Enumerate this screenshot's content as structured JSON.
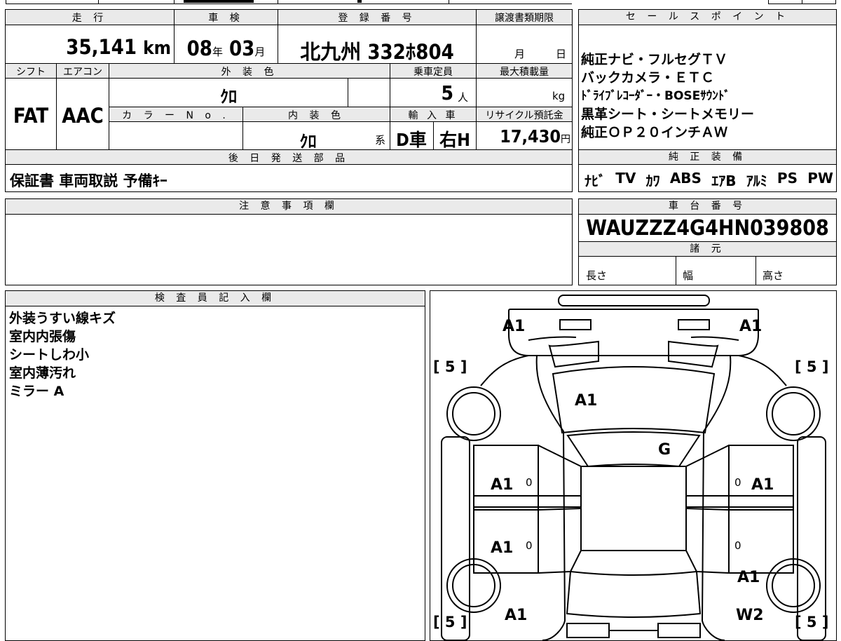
{
  "headers": {
    "mileage": "走 行",
    "inspection": "車 検",
    "registration": "登 録 番 号",
    "transfer_deadline": "譲渡書類期限",
    "sales_point": "セ ー ル ス ポ イ ン ト",
    "shift": "シフト",
    "aircon": "エアコン",
    "exterior_color": "外 装 色",
    "capacity": "乗車定員",
    "max_load": "最大積載量",
    "color_no": "カ ラ ー N o .",
    "interior_color": "内 装 色",
    "import": "輸 入 車",
    "recycle": "リサイクル預託金",
    "later_parts": "後 日 発 送 部 品",
    "genuine_equipment": "純 正 装 備",
    "notes": "注 意 事 項 欄",
    "chassis_no": "車 台 番 号",
    "specs": "諸 元",
    "inspector": "検 査 員 記 入 欄"
  },
  "vehicle": {
    "mileage_value": "35,141",
    "mileage_unit": "km",
    "inspection_year": "08",
    "year_unit": "年",
    "inspection_month": "03",
    "month_unit": "月",
    "registration_number": "北九州 332ﾎ804",
    "deadline_month": "月",
    "deadline_day": "日",
    "shift": "FAT",
    "aircon": "AAC",
    "exterior_color": "ｸﾛ",
    "capacity": "5",
    "capacity_unit": "人",
    "load_unit": "kg",
    "interior_color": "ｸﾛ",
    "interior_suffix": "系",
    "import_type": "D車",
    "handle": "右H",
    "recycle_fee": "17,430",
    "recycle_unit": "円",
    "later_parts": "保証書 車両取説 予備ｷｰ",
    "chassis_number": "WAUZZZ4G4HN039808",
    "spec_length": "長さ",
    "spec_width": "幅",
    "spec_height": "高さ"
  },
  "sales_points": [
    "純正ナビ・フルセグＴＶ",
    "バックカメラ・ＥＴＣ",
    "ﾄﾞﾗｲﾌﾞﾚｺｰﾀﾞｰ・BOSEｻｳﾝﾄﾞ",
    "黒革シート・シートメモリー",
    "純正ＯＰ２０インチＡＷ"
  ],
  "equipment": [
    "ﾅﾋﾞ",
    "TV",
    "ｶﾜ",
    "ABS",
    "ｴｱB",
    "ｱﾙﾐ",
    "PS",
    "PW"
  ],
  "inspector_notes": [
    "外装うすい線キズ",
    "室内内張傷",
    "シートしわ小",
    "室内薄汚れ",
    "ミラー A"
  ],
  "diagram": {
    "marks": {
      "front_left": "A1",
      "front_right": "A1",
      "bonnet": "A1",
      "windshield": "G",
      "front_door_left": "A1",
      "front_door_left_small": "0",
      "front_door_right": "A1",
      "front_door_right_small": "0",
      "rear_door_left": "A1",
      "rear_door_left_small": "0",
      "rear_door_right_small": "0",
      "rear_quarter_right": "A1",
      "rear_left": "A1",
      "rear_right": "W2"
    },
    "tire_tl": "[ 5 ]",
    "tire_tr": "[ 5 ]",
    "tire_bl": "[ 5 ]",
    "tire_br": "[ 5 ]"
  }
}
